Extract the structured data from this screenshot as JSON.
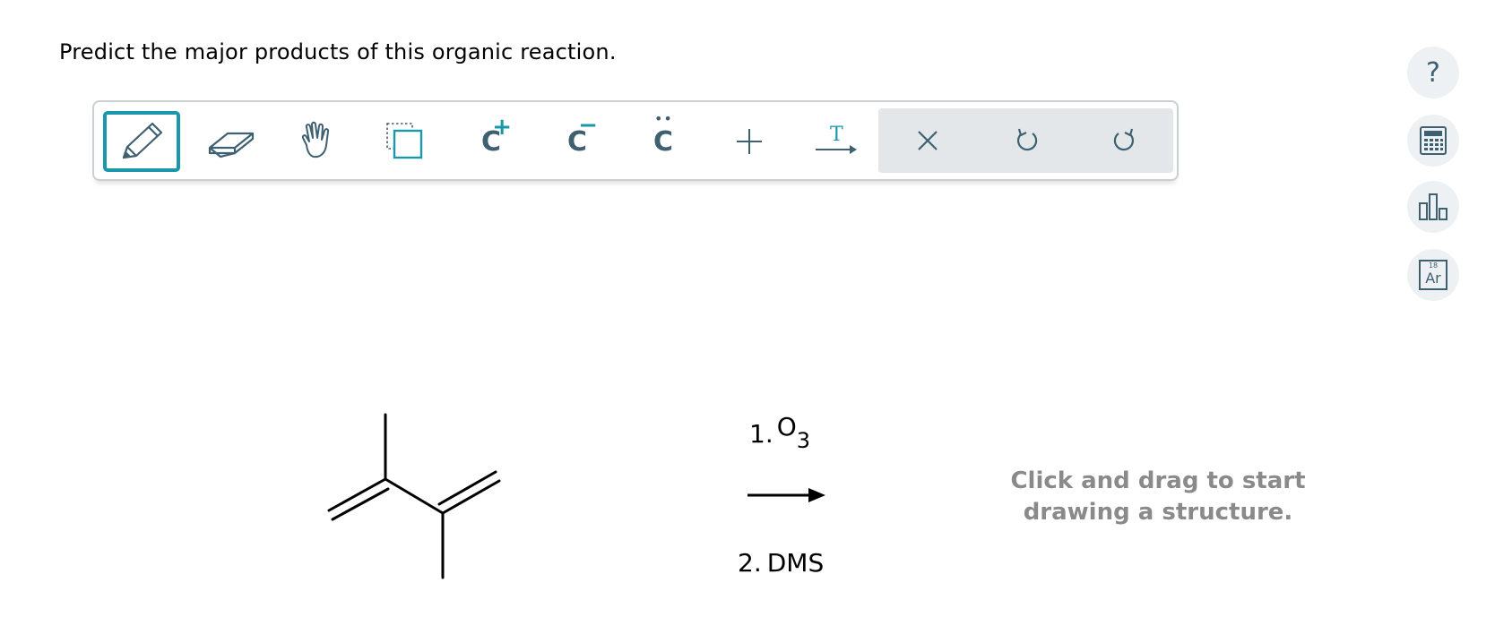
{
  "question": {
    "text": "Predict the major products of this organic reaction."
  },
  "toolbar": {
    "tools": [
      {
        "name": "pencil-icon",
        "active": true
      },
      {
        "name": "eraser-icon",
        "active": false
      },
      {
        "name": "hand-icon",
        "active": false
      },
      {
        "name": "select-copy-icon",
        "active": false
      },
      {
        "name": "carbocation-icon",
        "glyph": "C",
        "sup": "+"
      },
      {
        "name": "carbanion-icon",
        "glyph": "C",
        "sup": "−"
      },
      {
        "name": "lone-pair-icon",
        "glyph": "C",
        "dots": "••"
      },
      {
        "name": "plus-icon"
      },
      {
        "name": "reaction-arrow-text-icon",
        "glyph": "T"
      },
      {
        "name": "close-icon"
      },
      {
        "name": "undo-icon"
      },
      {
        "name": "redo-icon"
      }
    ],
    "accent": "#1a97ab",
    "icon_color": "#3f6070"
  },
  "sidebar": [
    {
      "name": "help-icon",
      "glyph": "?"
    },
    {
      "name": "calculator-icon"
    },
    {
      "name": "bar-chart-icon"
    },
    {
      "name": "periodic-table-icon",
      "number": "18",
      "symbol": "Ar"
    }
  ],
  "reaction": {
    "reagent_1_prefix": "1.",
    "reagent_1_main": "O",
    "reagent_1_sub": "3",
    "reagent_2_prefix": "2.",
    "reagent_2_main": "DMS"
  },
  "canvas": {
    "hint": "Click and drag to start\ndrawing a structure."
  }
}
